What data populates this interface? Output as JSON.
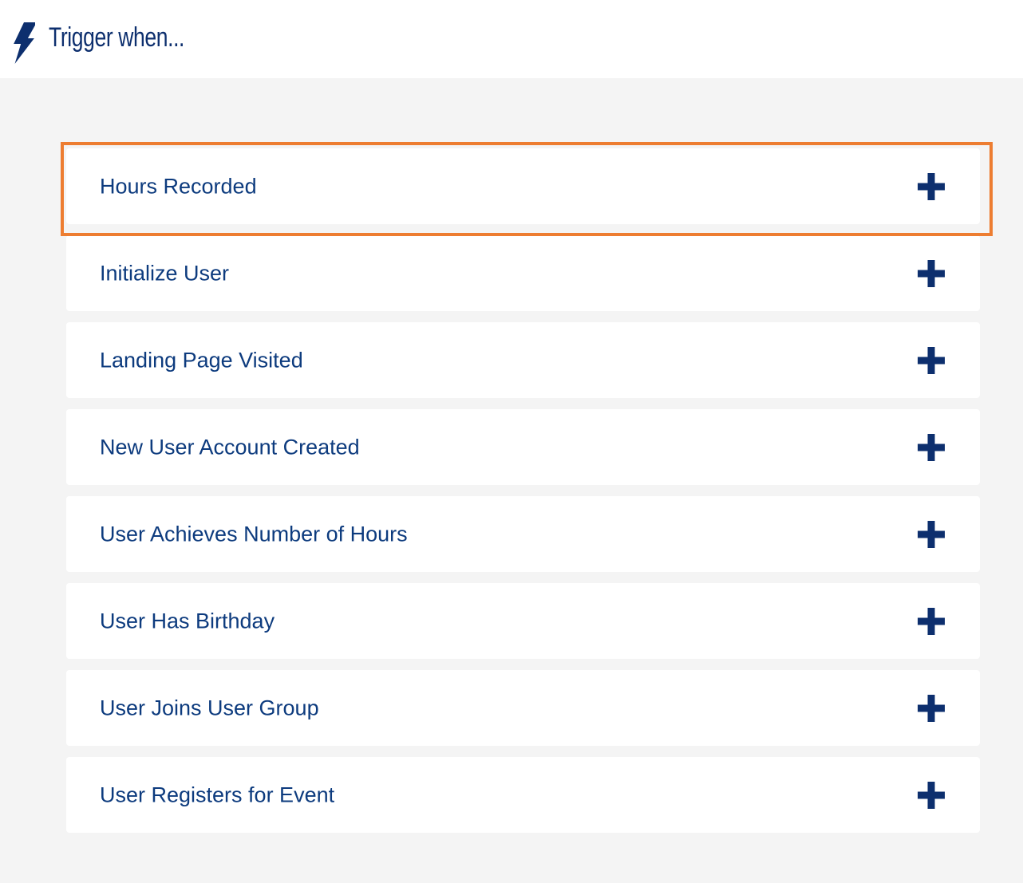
{
  "header": {
    "icon": "lightning-bolt-icon",
    "title": "Trigger when..."
  },
  "triggers": [
    {
      "label": "Hours Recorded",
      "action_icon": "plus-icon",
      "highlighted": true
    },
    {
      "label": "Initialize User",
      "action_icon": "plus-icon",
      "highlighted": false
    },
    {
      "label": "Landing Page Visited",
      "action_icon": "plus-icon",
      "highlighted": false
    },
    {
      "label": "New User Account Created",
      "action_icon": "plus-icon",
      "highlighted": false
    },
    {
      "label": "User Achieves Number of Hours",
      "action_icon": "plus-icon",
      "highlighted": false
    },
    {
      "label": "User Has Birthday",
      "action_icon": "plus-icon",
      "highlighted": false
    },
    {
      "label": "User Joins User Group",
      "action_icon": "plus-icon",
      "highlighted": false
    },
    {
      "label": "User Registers for Event",
      "action_icon": "plus-icon",
      "highlighted": false
    }
  ],
  "colors": {
    "text": "#0d3b7e",
    "icon": "#0d2f6e",
    "highlight": "#ed7d31",
    "background": "#f4f4f4",
    "card": "#ffffff"
  }
}
